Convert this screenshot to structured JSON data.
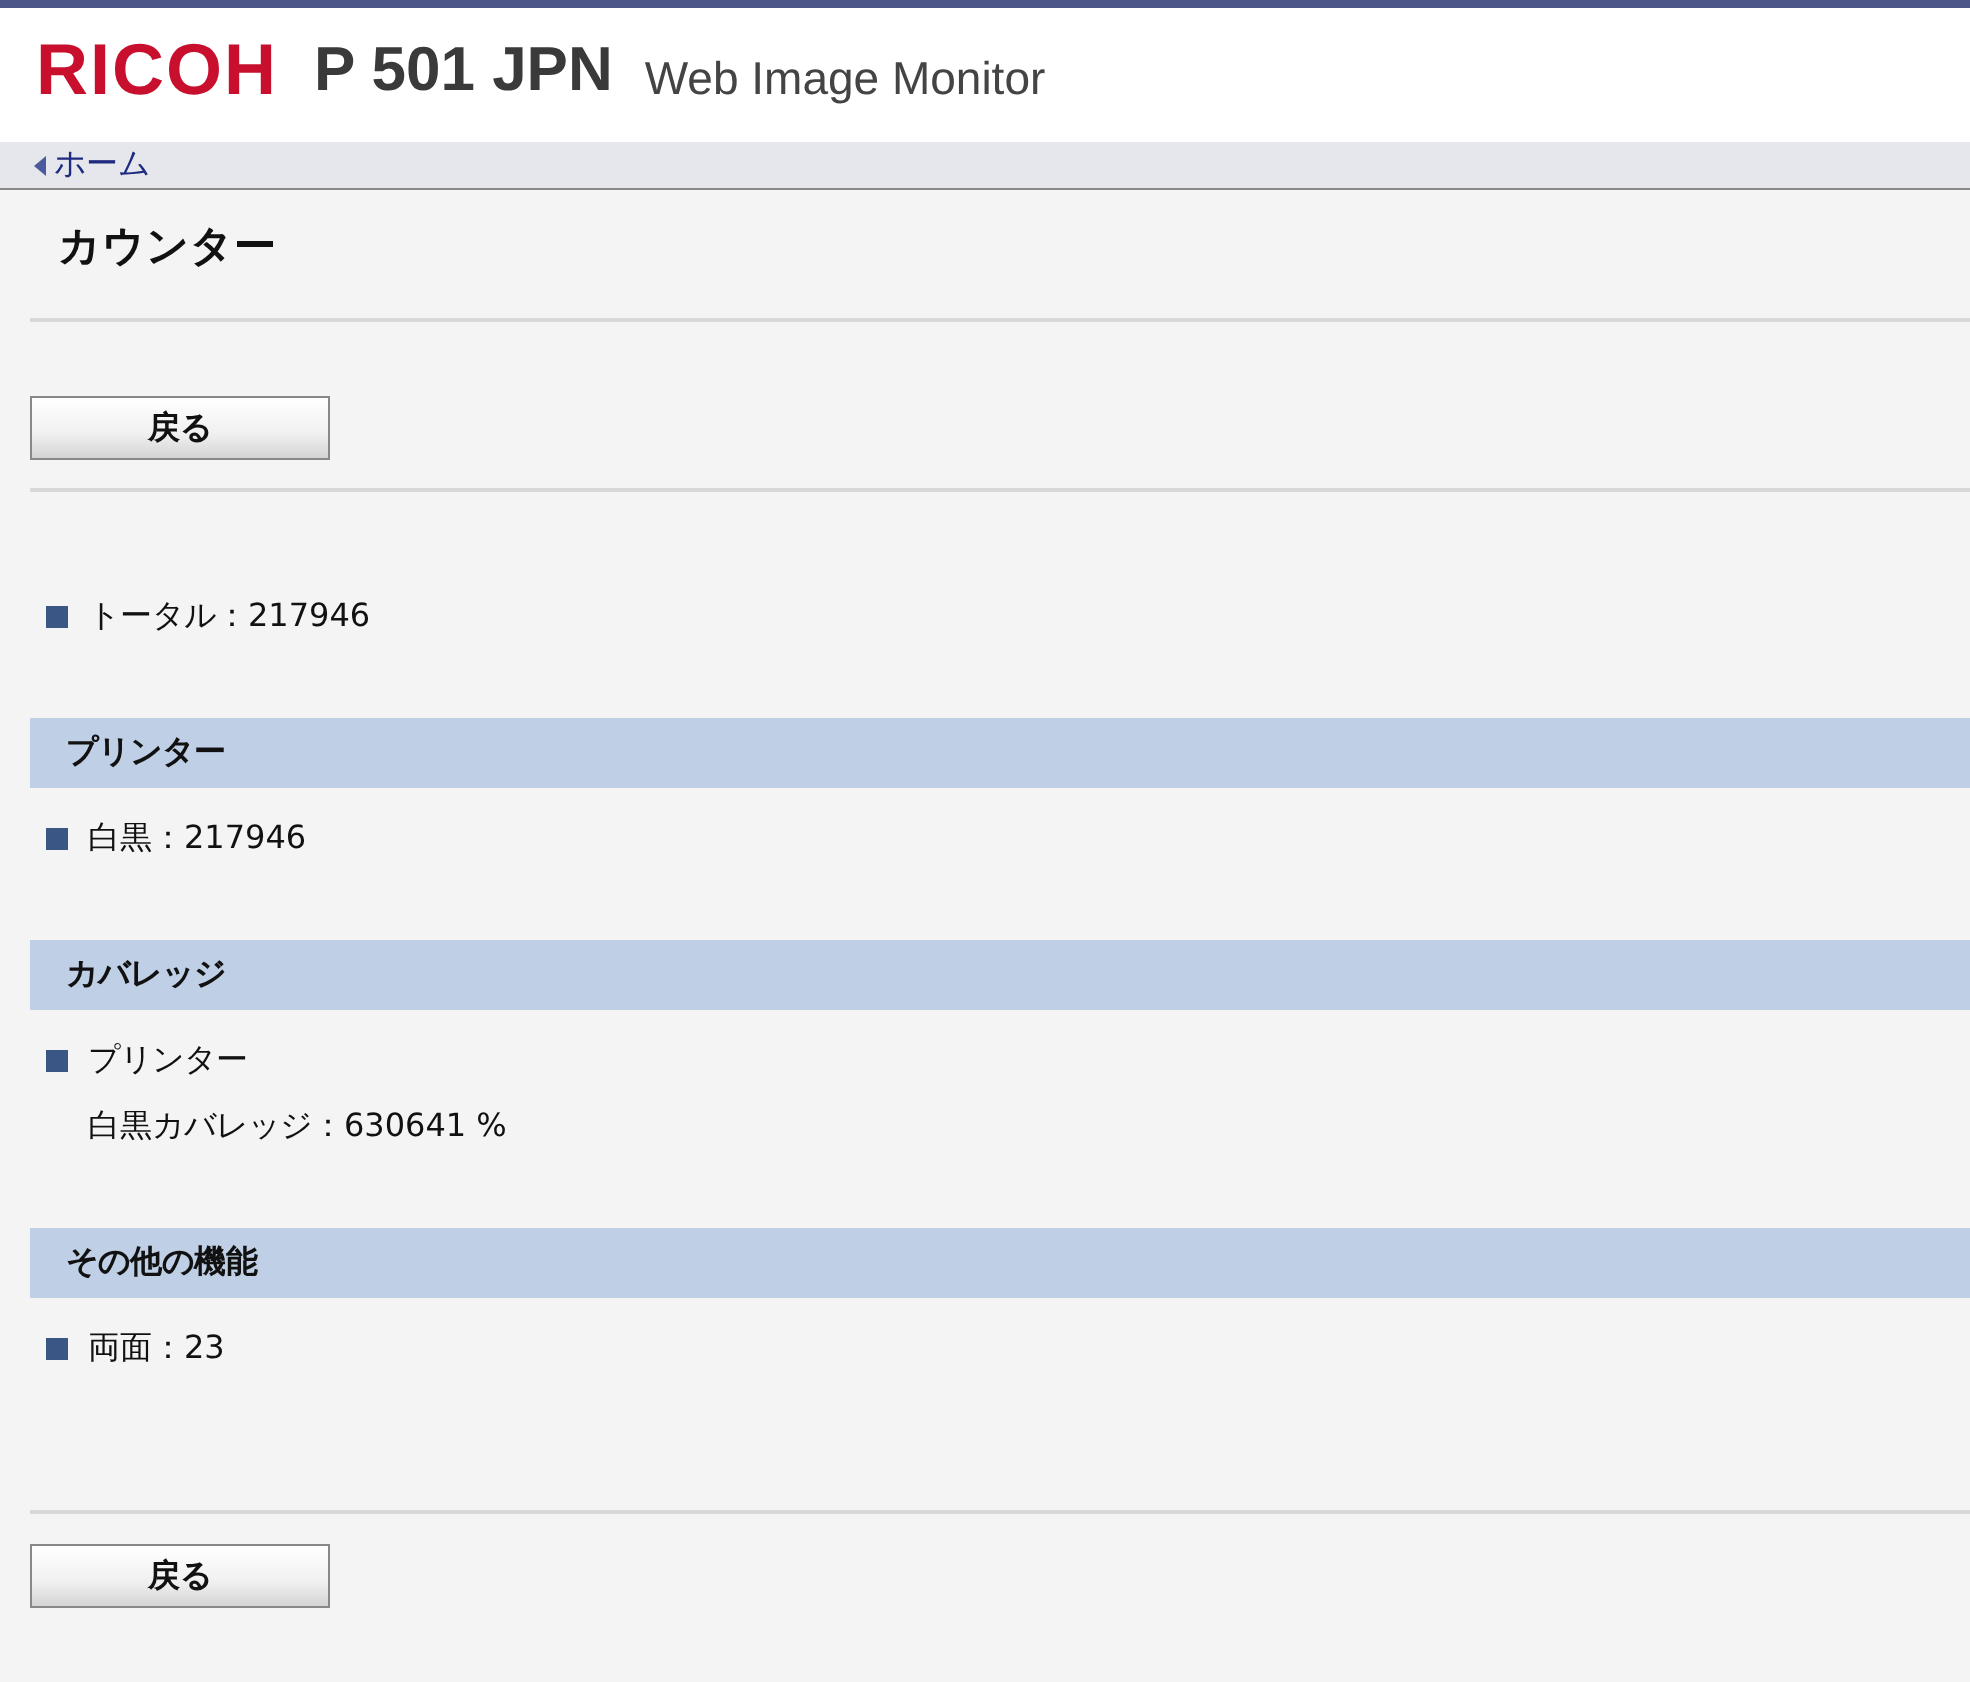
{
  "header": {
    "logo": "RICOH",
    "model": "P 501 JPN",
    "product": "Web Image Monitor"
  },
  "breadcrumb": {
    "label": "ホーム"
  },
  "page_title": "カウンター",
  "top_button": "戻る",
  "total": {
    "label": "トータル：217946"
  },
  "sections": [
    {
      "heading": "プリンター",
      "items": [
        {
          "label": "白黒：217946"
        }
      ]
    },
    {
      "heading": "カバレッジ",
      "items": [
        {
          "label": "プリンター",
          "details": [
            "白黒カバレッジ：630641 %"
          ]
        }
      ]
    },
    {
      "heading": "その他の機能",
      "items": [
        {
          "label": "両面：23"
        }
      ]
    }
  ],
  "bottom_button": "戻る"
}
